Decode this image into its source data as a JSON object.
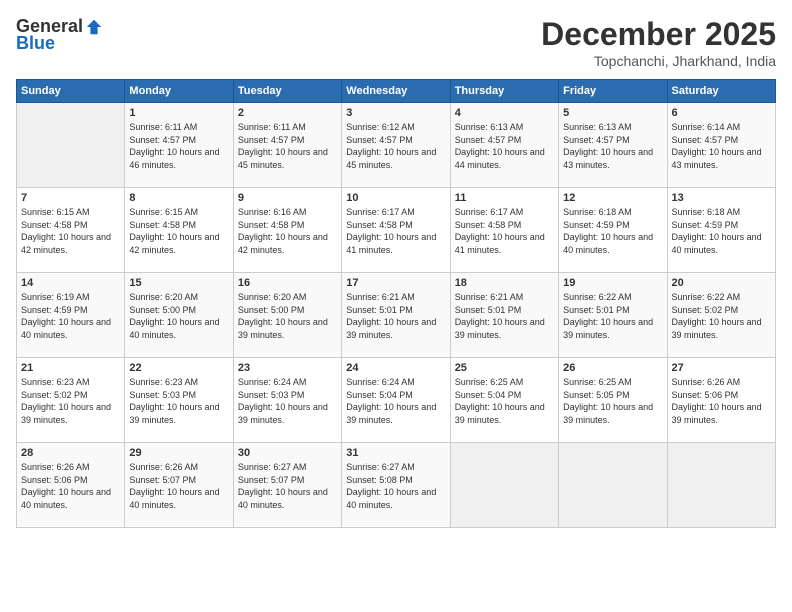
{
  "logo": {
    "general": "General",
    "blue": "Blue"
  },
  "header": {
    "month": "December 2025",
    "location": "Topchanchi, Jharkhand, India"
  },
  "days_of_week": [
    "Sunday",
    "Monday",
    "Tuesday",
    "Wednesday",
    "Thursday",
    "Friday",
    "Saturday"
  ],
  "weeks": [
    [
      {
        "day": "",
        "sunrise": "",
        "sunset": "",
        "daylight": "",
        "empty": true
      },
      {
        "day": "1",
        "sunrise": "Sunrise: 6:11 AM",
        "sunset": "Sunset: 4:57 PM",
        "daylight": "Daylight: 10 hours and 46 minutes."
      },
      {
        "day": "2",
        "sunrise": "Sunrise: 6:11 AM",
        "sunset": "Sunset: 4:57 PM",
        "daylight": "Daylight: 10 hours and 45 minutes."
      },
      {
        "day": "3",
        "sunrise": "Sunrise: 6:12 AM",
        "sunset": "Sunset: 4:57 PM",
        "daylight": "Daylight: 10 hours and 45 minutes."
      },
      {
        "day": "4",
        "sunrise": "Sunrise: 6:13 AM",
        "sunset": "Sunset: 4:57 PM",
        "daylight": "Daylight: 10 hours and 44 minutes."
      },
      {
        "day": "5",
        "sunrise": "Sunrise: 6:13 AM",
        "sunset": "Sunset: 4:57 PM",
        "daylight": "Daylight: 10 hours and 43 minutes."
      },
      {
        "day": "6",
        "sunrise": "Sunrise: 6:14 AM",
        "sunset": "Sunset: 4:57 PM",
        "daylight": "Daylight: 10 hours and 43 minutes."
      }
    ],
    [
      {
        "day": "7",
        "sunrise": "Sunrise: 6:15 AM",
        "sunset": "Sunset: 4:58 PM",
        "daylight": "Daylight: 10 hours and 42 minutes."
      },
      {
        "day": "8",
        "sunrise": "Sunrise: 6:15 AM",
        "sunset": "Sunset: 4:58 PM",
        "daylight": "Daylight: 10 hours and 42 minutes."
      },
      {
        "day": "9",
        "sunrise": "Sunrise: 6:16 AM",
        "sunset": "Sunset: 4:58 PM",
        "daylight": "Daylight: 10 hours and 42 minutes."
      },
      {
        "day": "10",
        "sunrise": "Sunrise: 6:17 AM",
        "sunset": "Sunset: 4:58 PM",
        "daylight": "Daylight: 10 hours and 41 minutes."
      },
      {
        "day": "11",
        "sunrise": "Sunrise: 6:17 AM",
        "sunset": "Sunset: 4:58 PM",
        "daylight": "Daylight: 10 hours and 41 minutes."
      },
      {
        "day": "12",
        "sunrise": "Sunrise: 6:18 AM",
        "sunset": "Sunset: 4:59 PM",
        "daylight": "Daylight: 10 hours and 40 minutes."
      },
      {
        "day": "13",
        "sunrise": "Sunrise: 6:18 AM",
        "sunset": "Sunset: 4:59 PM",
        "daylight": "Daylight: 10 hours and 40 minutes."
      }
    ],
    [
      {
        "day": "14",
        "sunrise": "Sunrise: 6:19 AM",
        "sunset": "Sunset: 4:59 PM",
        "daylight": "Daylight: 10 hours and 40 minutes."
      },
      {
        "day": "15",
        "sunrise": "Sunrise: 6:20 AM",
        "sunset": "Sunset: 5:00 PM",
        "daylight": "Daylight: 10 hours and 40 minutes."
      },
      {
        "day": "16",
        "sunrise": "Sunrise: 6:20 AM",
        "sunset": "Sunset: 5:00 PM",
        "daylight": "Daylight: 10 hours and 39 minutes."
      },
      {
        "day": "17",
        "sunrise": "Sunrise: 6:21 AM",
        "sunset": "Sunset: 5:01 PM",
        "daylight": "Daylight: 10 hours and 39 minutes."
      },
      {
        "day": "18",
        "sunrise": "Sunrise: 6:21 AM",
        "sunset": "Sunset: 5:01 PM",
        "daylight": "Daylight: 10 hours and 39 minutes."
      },
      {
        "day": "19",
        "sunrise": "Sunrise: 6:22 AM",
        "sunset": "Sunset: 5:01 PM",
        "daylight": "Daylight: 10 hours and 39 minutes."
      },
      {
        "day": "20",
        "sunrise": "Sunrise: 6:22 AM",
        "sunset": "Sunset: 5:02 PM",
        "daylight": "Daylight: 10 hours and 39 minutes."
      }
    ],
    [
      {
        "day": "21",
        "sunrise": "Sunrise: 6:23 AM",
        "sunset": "Sunset: 5:02 PM",
        "daylight": "Daylight: 10 hours and 39 minutes."
      },
      {
        "day": "22",
        "sunrise": "Sunrise: 6:23 AM",
        "sunset": "Sunset: 5:03 PM",
        "daylight": "Daylight: 10 hours and 39 minutes."
      },
      {
        "day": "23",
        "sunrise": "Sunrise: 6:24 AM",
        "sunset": "Sunset: 5:03 PM",
        "daylight": "Daylight: 10 hours and 39 minutes."
      },
      {
        "day": "24",
        "sunrise": "Sunrise: 6:24 AM",
        "sunset": "Sunset: 5:04 PM",
        "daylight": "Daylight: 10 hours and 39 minutes."
      },
      {
        "day": "25",
        "sunrise": "Sunrise: 6:25 AM",
        "sunset": "Sunset: 5:04 PM",
        "daylight": "Daylight: 10 hours and 39 minutes."
      },
      {
        "day": "26",
        "sunrise": "Sunrise: 6:25 AM",
        "sunset": "Sunset: 5:05 PM",
        "daylight": "Daylight: 10 hours and 39 minutes."
      },
      {
        "day": "27",
        "sunrise": "Sunrise: 6:26 AM",
        "sunset": "Sunset: 5:06 PM",
        "daylight": "Daylight: 10 hours and 39 minutes."
      }
    ],
    [
      {
        "day": "28",
        "sunrise": "Sunrise: 6:26 AM",
        "sunset": "Sunset: 5:06 PM",
        "daylight": "Daylight: 10 hours and 40 minutes."
      },
      {
        "day": "29",
        "sunrise": "Sunrise: 6:26 AM",
        "sunset": "Sunset: 5:07 PM",
        "daylight": "Daylight: 10 hours and 40 minutes."
      },
      {
        "day": "30",
        "sunrise": "Sunrise: 6:27 AM",
        "sunset": "Sunset: 5:07 PM",
        "daylight": "Daylight: 10 hours and 40 minutes."
      },
      {
        "day": "31",
        "sunrise": "Sunrise: 6:27 AM",
        "sunset": "Sunset: 5:08 PM",
        "daylight": "Daylight: 10 hours and 40 minutes."
      },
      {
        "day": "",
        "sunrise": "",
        "sunset": "",
        "daylight": "",
        "empty": true
      },
      {
        "day": "",
        "sunrise": "",
        "sunset": "",
        "daylight": "",
        "empty": true
      },
      {
        "day": "",
        "sunrise": "",
        "sunset": "",
        "daylight": "",
        "empty": true
      }
    ]
  ]
}
